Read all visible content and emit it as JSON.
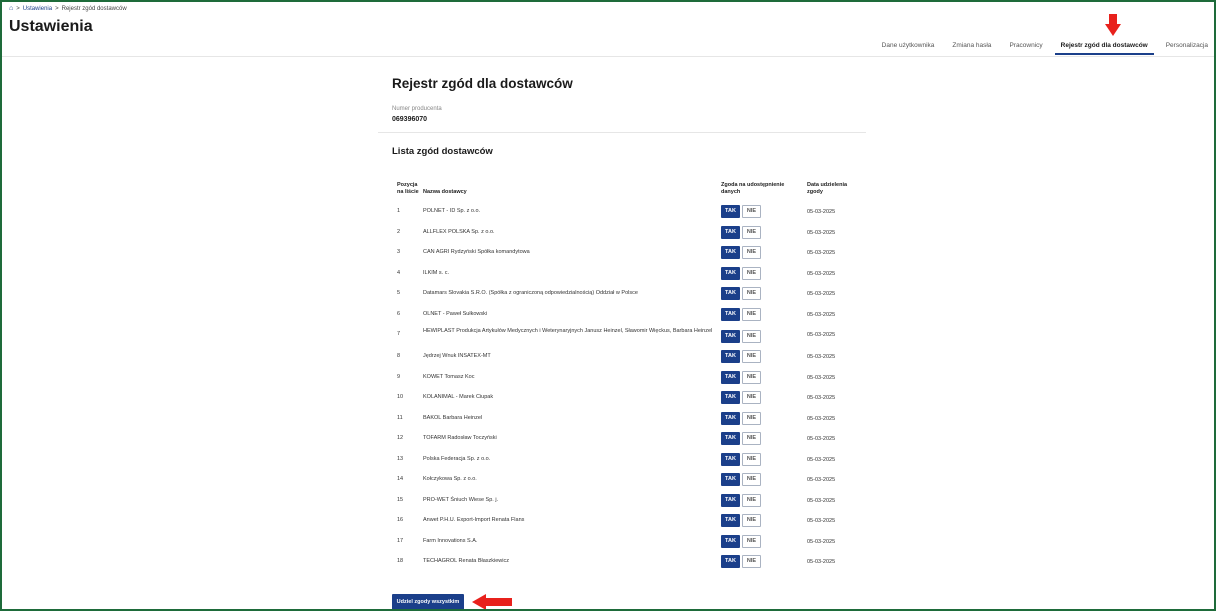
{
  "breadcrumb": {
    "home_icon": "⌂",
    "sep": ">",
    "settings": "Ustawienia",
    "current": "Rejestr zgód dostawców"
  },
  "page_title": "Ustawienia",
  "tabs": [
    {
      "label": "Dane użytkownika"
    },
    {
      "label": "Zmiana hasła"
    },
    {
      "label": "Pracownicy"
    },
    {
      "label": "Rejestr zgód dla dostawców",
      "active": true
    },
    {
      "label": "Personalizacja"
    }
  ],
  "heading": "Rejestr zgód dla dostawców",
  "producer": {
    "label": "Numer producenta",
    "value": "069396070"
  },
  "list_heading": "Lista zgód dostawców",
  "columns": {
    "position": "Pozycja na liście",
    "name": "Nazwa dostawcy",
    "consent": "Zgoda na udostępnienie danych",
    "date": "Data udzielenia zgody"
  },
  "buttons": {
    "tak": "TAK",
    "nie": "NIE",
    "grant_all": "Udziel zgody wszystkim"
  },
  "rows": [
    {
      "pos": "1",
      "name": "POLNET - ID Sp. z o.o.",
      "date": "05-03-2025"
    },
    {
      "pos": "2",
      "name": "ALLFLEX POLSKA Sp. z o.o.",
      "date": "05-03-2025"
    },
    {
      "pos": "3",
      "name": "CAN AGRI Rydzyński Spółka komandytowa",
      "date": "05-03-2025"
    },
    {
      "pos": "4",
      "name": "ILKIM s. c.",
      "date": "05-03-2025"
    },
    {
      "pos": "5",
      "name": "Datamars Slovakia S.R.O. (Spółka z ograniczoną odpowiedzialnością) Oddział w Polsce",
      "date": "05-03-2025"
    },
    {
      "pos": "6",
      "name": "OLNET - Paweł Sułkowski",
      "date": "05-03-2025"
    },
    {
      "pos": "7",
      "name": "HEWIPLAST Produkcja Artykułów Medycznych i Weterynaryjnych Janusz Heinzel, Sławomir Więckus, Barbara Heinzel",
      "date": "05-03-2025"
    },
    {
      "pos": "8",
      "name": "Jędrzej Wnuk INSATEX-MT",
      "date": "05-03-2025"
    },
    {
      "pos": "9",
      "name": "KOWET Tomasz Koc",
      "date": "05-03-2025"
    },
    {
      "pos": "10",
      "name": "KOLANIMAL - Marek Ciupak",
      "date": "05-03-2025"
    },
    {
      "pos": "11",
      "name": "BAKOL Barbara Heinzel",
      "date": "05-03-2025"
    },
    {
      "pos": "12",
      "name": "TOFARM Radosław Toczyński",
      "date": "05-03-2025"
    },
    {
      "pos": "13",
      "name": "Polska Federacja Sp. z o.o.",
      "date": "05-03-2025"
    },
    {
      "pos": "14",
      "name": "Kołczykowa Sp. z o.o.",
      "date": "05-03-2025"
    },
    {
      "pos": "15",
      "name": "PRO-WET Śniuch Wiese Sp. j.",
      "date": "05-03-2025"
    },
    {
      "pos": "16",
      "name": "Anwet P.H.U. Export-Import Renata Flans",
      "date": "05-03-2025"
    },
    {
      "pos": "17",
      "name": "Farm Innovations S.A.",
      "date": "05-03-2025"
    },
    {
      "pos": "18",
      "name": "TECHAGROL Renata Błaszkiewicz",
      "date": "05-03-2025"
    }
  ],
  "colors": {
    "primary": "#1b3f8a",
    "annotation_arrow": "#e8211c",
    "frame": "#1e6b3a"
  }
}
